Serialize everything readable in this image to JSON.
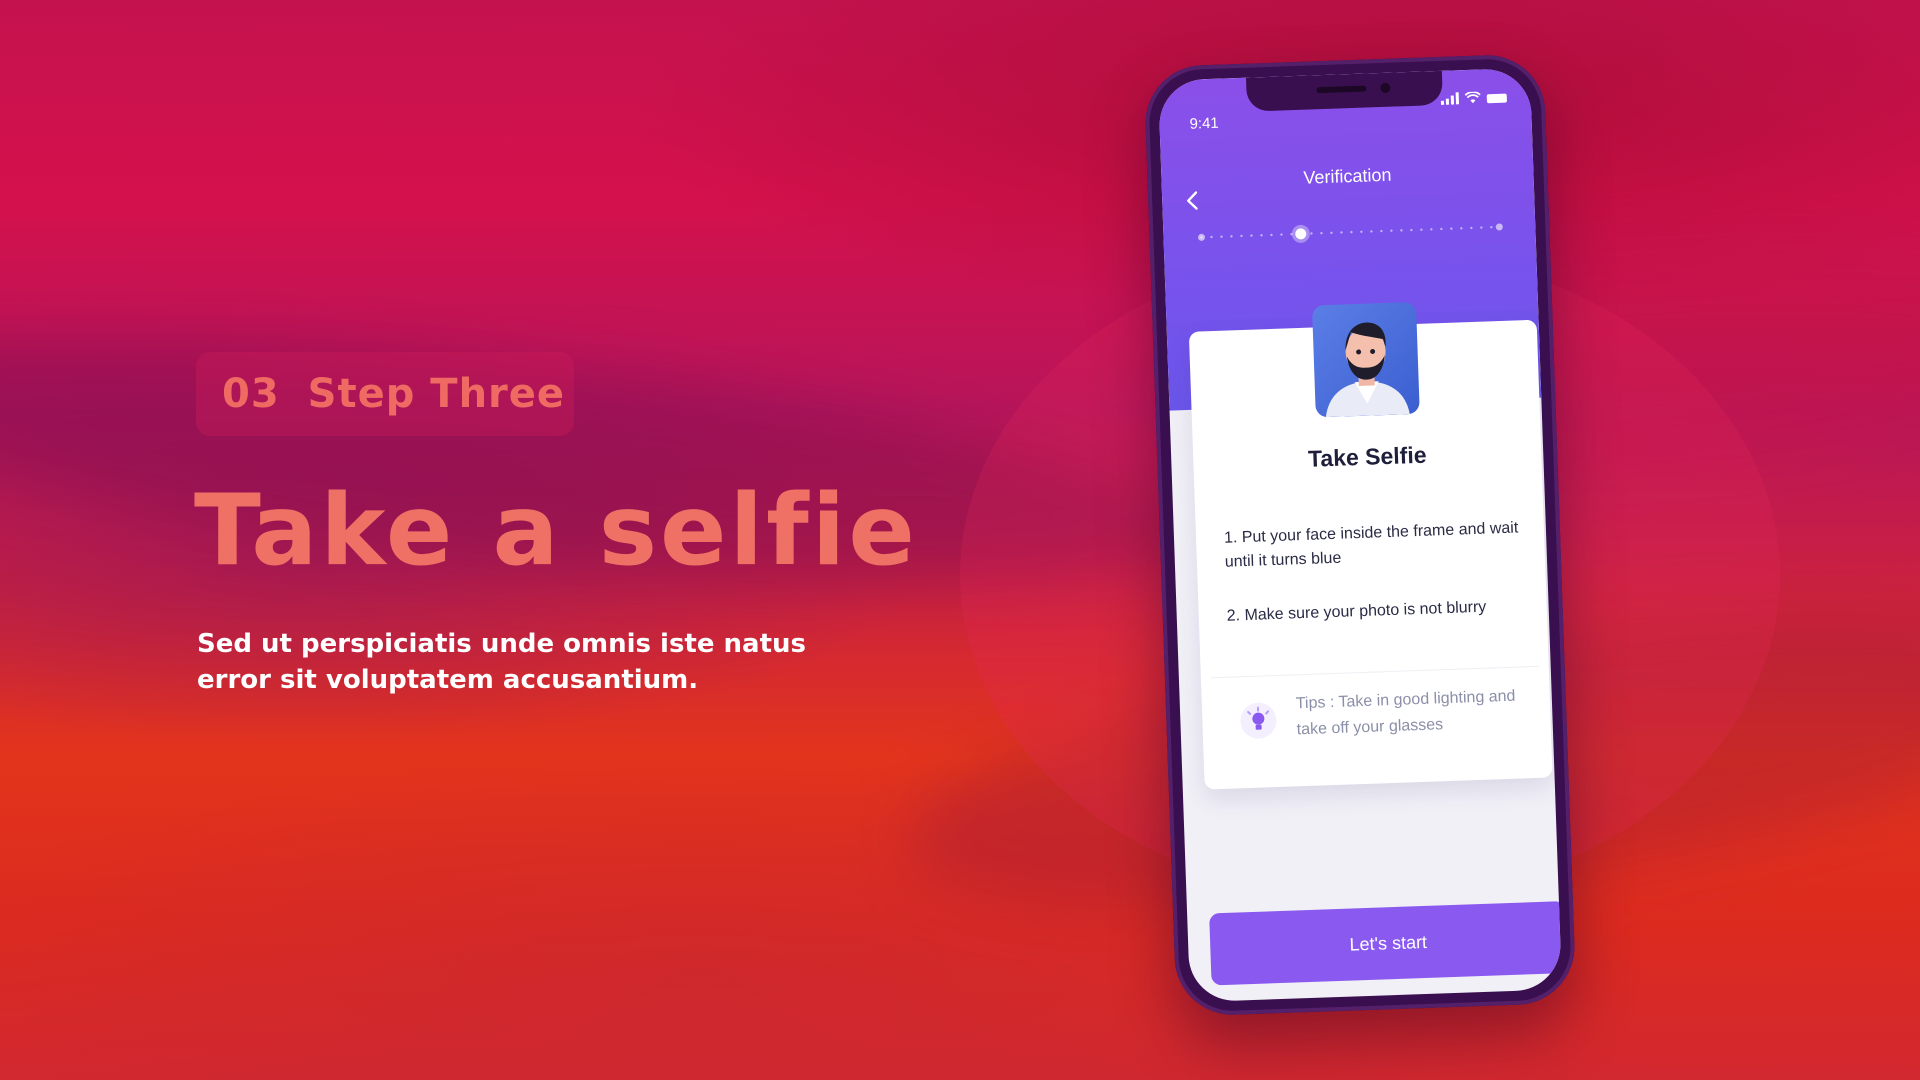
{
  "slide": {
    "step_number": "03",
    "step_label": "Step Three",
    "headline": "Take a selfie",
    "description": "Sed ut perspiciatis unde omnis iste natus error sit voluptatem accusantium."
  },
  "phone": {
    "status_time": "9:41",
    "screen_title": "Verification",
    "progress": {
      "current_step": 3,
      "total_steps": 7
    },
    "card": {
      "title": "Take Selfie",
      "instructions": [
        "1.  Put your face inside the frame and wait until it turns blue",
        "2.  Make sure your photo is not blurry"
      ],
      "tip": "Tips : Take in good lighting and take off your glasses"
    },
    "cta_label": "Let's start"
  },
  "colors": {
    "accent_coral": "#ef6a63",
    "phone_purple": "#8a5af0",
    "background_red": "#d4114c"
  },
  "icons": [
    "back-arrow-icon",
    "signal-icon",
    "wifi-icon",
    "battery-icon",
    "lightbulb-icon"
  ]
}
